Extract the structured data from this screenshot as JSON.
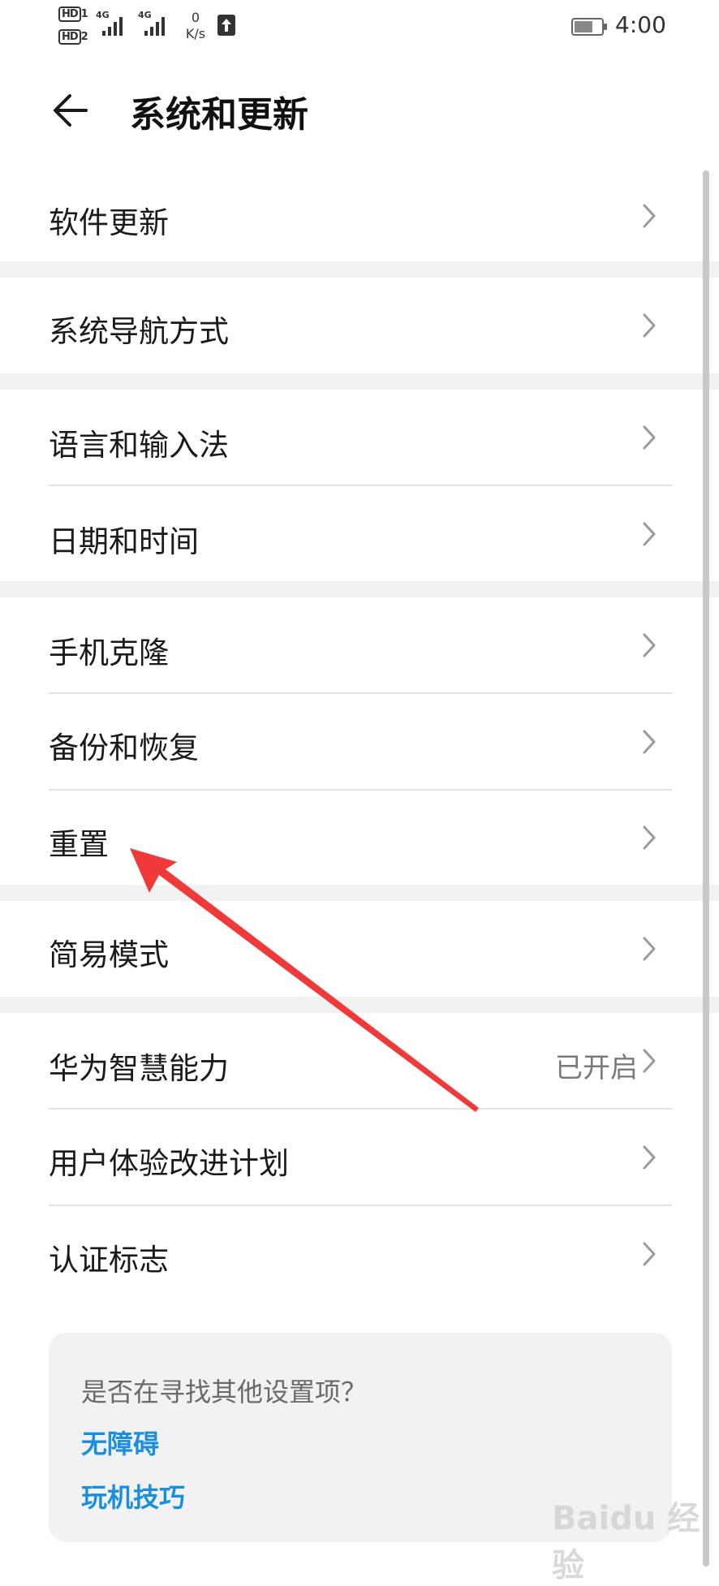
{
  "status_bar": {
    "hd1": "HD",
    "hd1_sub": "1",
    "hd2": "HD",
    "hd2_sub": "2",
    "network1": "4G",
    "network2": "4G",
    "speed_value": "0",
    "speed_unit": "K/s",
    "time": "4:00"
  },
  "header": {
    "title": "系统和更新",
    "back_icon": "arrow-left-icon"
  },
  "groups": [
    {
      "items": [
        {
          "label": "软件更新"
        }
      ]
    },
    {
      "items": [
        {
          "label": "系统导航方式"
        }
      ]
    },
    {
      "items": [
        {
          "label": "语言和输入法"
        },
        {
          "label": "日期和时间"
        }
      ]
    },
    {
      "items": [
        {
          "label": "手机克隆"
        },
        {
          "label": "备份和恢复"
        },
        {
          "label": "重置"
        }
      ]
    },
    {
      "items": [
        {
          "label": "简易模式"
        }
      ]
    },
    {
      "items": [
        {
          "label": "华为智慧能力",
          "value": "已开启"
        },
        {
          "label": "用户体验改进计划"
        },
        {
          "label": "认证标志"
        }
      ]
    }
  ],
  "suggestion": {
    "title": "是否在寻找其他设置项？",
    "links": [
      "无障碍",
      "玩机技巧"
    ]
  },
  "watermark": "Baidu 经验",
  "colors": {
    "link": "#1a8fe0",
    "annotation_arrow": "#f03a3a",
    "group_gap": "#f2f2f2"
  }
}
